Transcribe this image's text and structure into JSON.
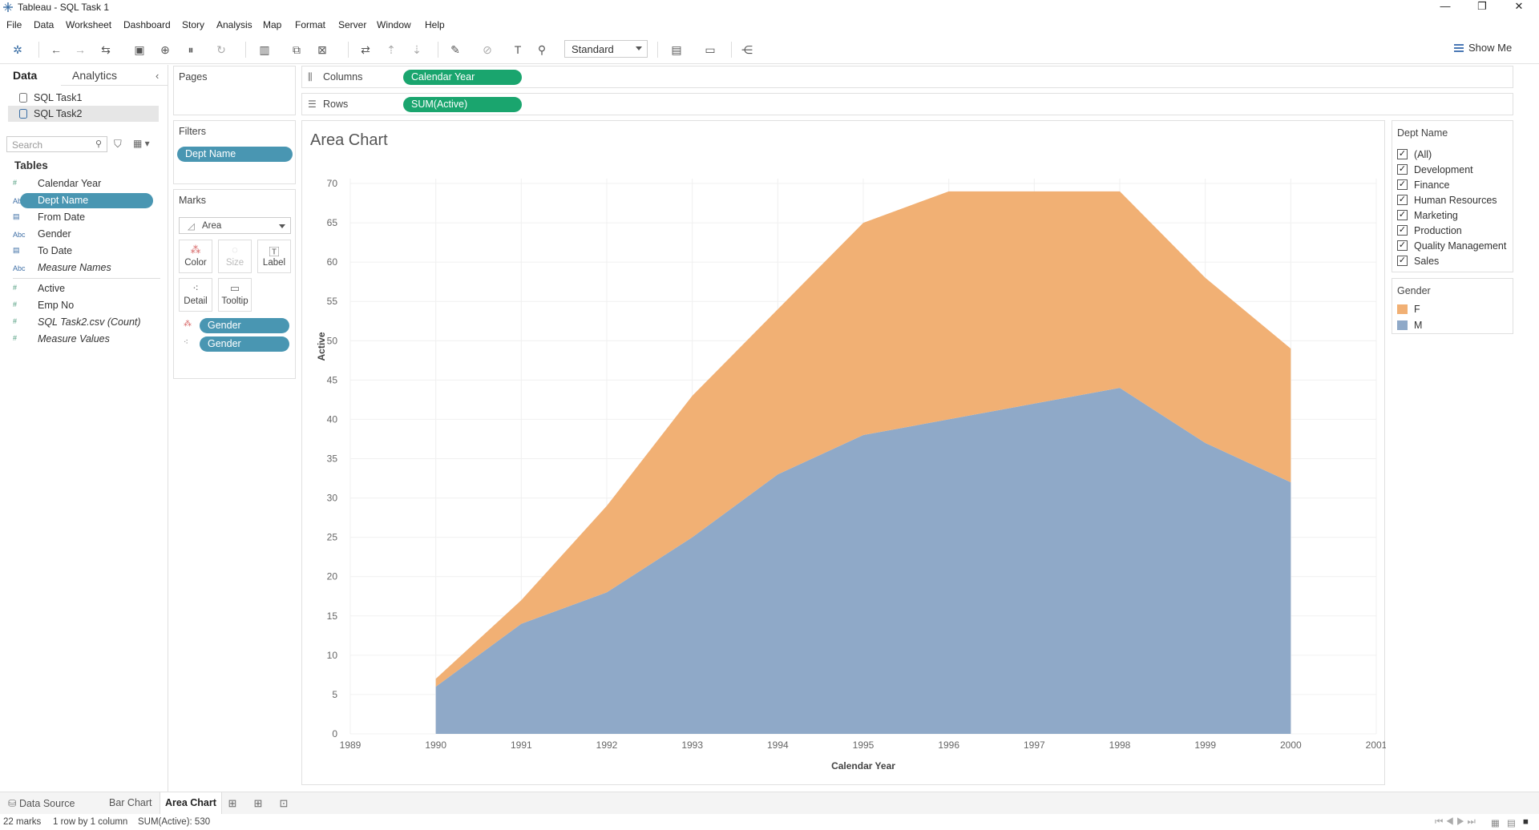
{
  "window": {
    "title": "Tableau - SQL Task 1",
    "minimize": "—",
    "restore": "❐",
    "close": "✕"
  },
  "menu": [
    "File",
    "Data",
    "Worksheet",
    "Dashboard",
    "Story",
    "Analysis",
    "Map",
    "Format",
    "Server",
    "Window",
    "Help"
  ],
  "toolbar": {
    "fit_select": "Standard",
    "show_me": "Show Me"
  },
  "datapane": {
    "tabs": [
      "Data",
      "Analytics"
    ],
    "collapse_icon": "chevron-left-icon",
    "datasources": [
      "SQL Task1",
      "SQL Task2"
    ],
    "search_placeholder": "Search",
    "tables_header": "Tables",
    "fields": [
      {
        "name": "Calendar Year",
        "type": "#"
      },
      {
        "name": "Dept Name",
        "type": "Abc"
      },
      {
        "name": "From Date",
        "type": "date"
      },
      {
        "name": "Gender",
        "type": "Abc"
      },
      {
        "name": "To Date",
        "type": "date"
      },
      {
        "name": "Measure Names",
        "type": "Abc"
      },
      {
        "name": "Active",
        "type": "#"
      },
      {
        "name": "Emp No",
        "type": "#"
      },
      {
        "name": "SQL Task2.csv (Count)",
        "type": "#"
      },
      {
        "name": "Measure Values",
        "type": "#"
      }
    ]
  },
  "cards": {
    "pages": "Pages",
    "filters": {
      "title": "Filters",
      "pills": [
        "Dept Name"
      ]
    },
    "marks": {
      "title": "Marks",
      "type": "Area",
      "buttons": [
        "Color",
        "Size",
        "Label",
        "Detail",
        "Tooltip"
      ],
      "pills": [
        "Gender",
        "Gender"
      ]
    }
  },
  "shelves": {
    "columns": {
      "label": "Columns",
      "pill": "Calendar Year"
    },
    "rows": {
      "label": "Rows",
      "pill": "SUM(Active)"
    }
  },
  "legends": {
    "dept": {
      "title": "Dept Name",
      "items": [
        "(All)",
        "Development",
        "Finance",
        "Human Resources",
        "Marketing",
        "Production",
        "Quality Management",
        "Sales"
      ]
    },
    "gender": {
      "title": "Gender",
      "items": [
        {
          "name": "F",
          "color": "#f1b074"
        },
        {
          "name": "M",
          "color": "#8fa9c8"
        }
      ]
    }
  },
  "colors": {
    "accent_blue": "#4996b2",
    "accent_green": "#1aa56e",
    "female": "#f1b074",
    "male": "#8fa9c8"
  },
  "chart_data": {
    "type": "area",
    "title": "Area Chart",
    "xlabel": "Calendar Year",
    "ylabel": "Active",
    "x_ticks": [
      1989,
      1990,
      1991,
      1992,
      1993,
      1994,
      1995,
      1996,
      1997,
      1998,
      1999,
      2000,
      2001
    ],
    "y_ticks": [
      0,
      5,
      10,
      15,
      20,
      25,
      30,
      35,
      40,
      45,
      50,
      55,
      60,
      65,
      70
    ],
    "xlim": [
      1989,
      2001
    ],
    "ylim": [
      0,
      70
    ],
    "stacked": true,
    "grid": true,
    "x": [
      1990,
      1991,
      1992,
      1993,
      1994,
      1995,
      1996,
      1997,
      1998,
      1999,
      2000
    ],
    "series": [
      {
        "name": "M",
        "color": "#8fa9c8",
        "values": [
          6,
          14,
          18,
          25,
          33,
          38,
          40,
          42,
          44,
          37,
          32
        ]
      },
      {
        "name": "F",
        "color": "#f1b074",
        "values": [
          1,
          3,
          11,
          18,
          21,
          27,
          29,
          27,
          25,
          21,
          17
        ]
      }
    ]
  },
  "sheets": {
    "data_source": "Data Source",
    "tabs": [
      "Bar Chart",
      "Area Chart"
    ],
    "active": "Area Chart"
  },
  "status": {
    "marks": "22 marks",
    "layout": "1 row by 1 column",
    "sum": "SUM(Active): 530"
  }
}
